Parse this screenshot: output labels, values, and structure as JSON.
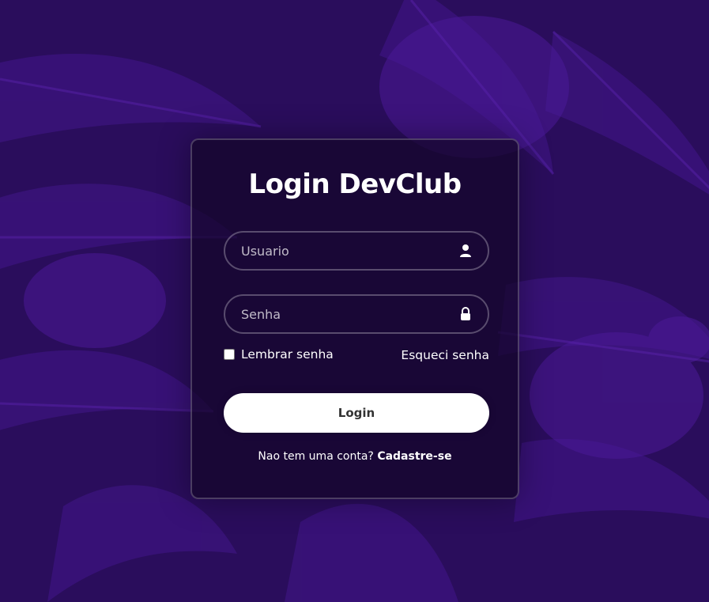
{
  "login": {
    "title": "Login DevClub",
    "username_placeholder": "Usuario",
    "password_placeholder": "Senha",
    "remember_label": "Lembrar senha",
    "forgot_label": "Esqueci senha",
    "button_label": "Login",
    "register_prompt": "Nao tem uma conta?",
    "register_link": "Cadastre-se"
  },
  "icons": {
    "username": "user-icon",
    "password": "lock-icon"
  },
  "colors": {
    "background": "#2a0d5c",
    "card": "#140628",
    "text": "#ffffff",
    "button": "#ffffff",
    "button_text": "#333333"
  }
}
